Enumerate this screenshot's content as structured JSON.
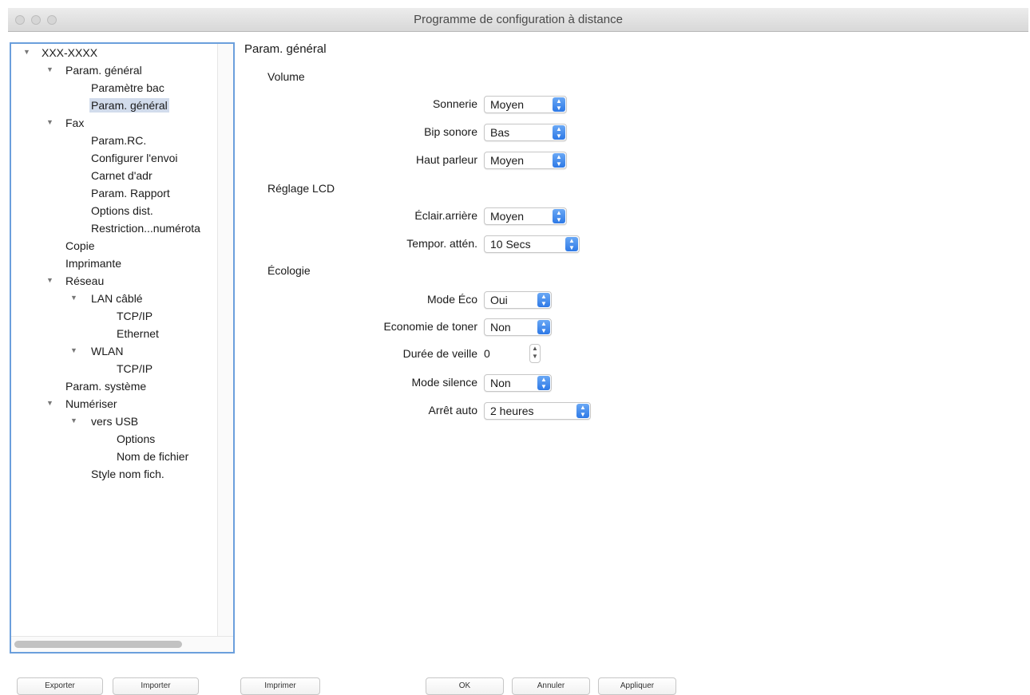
{
  "window": {
    "title": "Programme de configuration à distance"
  },
  "tree": {
    "root": "XXX-XXXX",
    "items": [
      "Param. général",
      "Paramètre bac",
      "Param. général",
      "Fax",
      "Param.RC.",
      "Configurer l'envoi",
      "Carnet d'adr",
      "Param. Rapport",
      "Options dist.",
      "Restriction...numérota",
      "Copie",
      "Imprimante",
      "Réseau",
      "LAN câblé",
      "TCP/IP",
      "Ethernet",
      "WLAN",
      "TCP/IP",
      "Param. système",
      "Numériser",
      "vers USB",
      "Options",
      "Nom de fichier",
      "Style nom fich."
    ],
    "selected": "Param. général"
  },
  "main": {
    "heading": "Param. général",
    "sections": {
      "volume": "Volume",
      "lcd": "Réglage LCD",
      "eco": "Écologie"
    },
    "fields": {
      "sonnerie": {
        "label": "Sonnerie",
        "value": "Moyen"
      },
      "bip": {
        "label": "Bip sonore",
        "value": "Bas"
      },
      "haut_parleur": {
        "label": "Haut parleur",
        "value": "Moyen"
      },
      "eclair": {
        "label": "Éclair.arrière",
        "value": "Moyen"
      },
      "tempor": {
        "label": "Tempor. attén.",
        "value": "10 Secs"
      },
      "mode_eco": {
        "label": "Mode Éco",
        "value": "Oui"
      },
      "eco_toner": {
        "label": "Economie de toner",
        "value": "Non"
      },
      "veille": {
        "label": "Durée de veille",
        "value": "0"
      },
      "silence": {
        "label": "Mode silence",
        "value": "Non"
      },
      "arret": {
        "label": "Arrêt auto",
        "value": "2 heures"
      }
    }
  },
  "buttons": {
    "exporter": "Exporter",
    "importer": "Importer",
    "imprimer": "Imprimer",
    "ok": "OK",
    "annuler": "Annuler",
    "appliquer": "Appliquer"
  },
  "colors": {
    "accent": "#2e79e6",
    "focus_border": "#6b9fdc",
    "selection": "#d2dcec"
  }
}
